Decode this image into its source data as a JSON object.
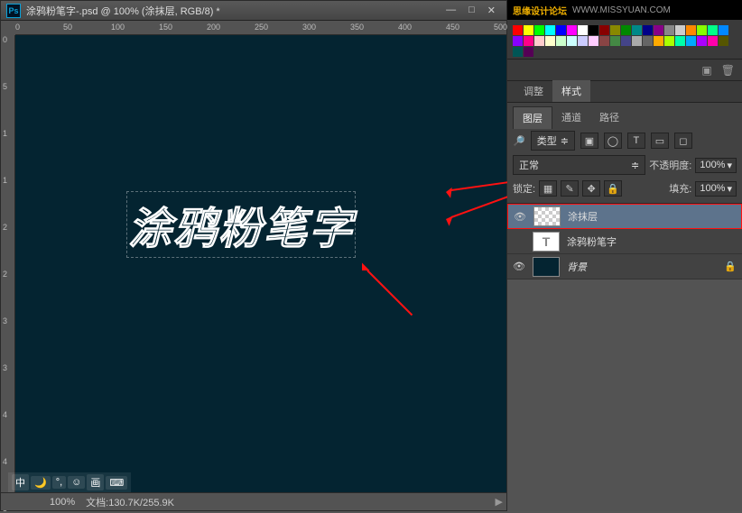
{
  "title": "涂鸦粉笔字-.psd @ 100% (涂抹层, RGB/8) *",
  "rulerH": [
    "0",
    "50",
    "100",
    "150",
    "200",
    "250",
    "300",
    "350",
    "400",
    "450",
    "500"
  ],
  "rulerV": [
    "0",
    "5",
    "1",
    "1",
    "2",
    "2",
    "3",
    "3",
    "4",
    "4",
    "5"
  ],
  "canvasText": "涂鸦粉笔字",
  "status": {
    "zoom": "100%",
    "docinfo": "文档:130.7K/255.9K"
  },
  "taskbar": [
    "中",
    "🌙",
    "°,",
    "☺",
    "画",
    "⌨"
  ],
  "watermark": {
    "brand": "思缘设计论坛",
    "url": "WWW.MISSYUAN.COM"
  },
  "tabsTop": {
    "adjust": "调整",
    "styles": "样式"
  },
  "tabsLayers": {
    "layers": "图层",
    "channels": "通道",
    "paths": "路径"
  },
  "filter": {
    "label": "类型",
    "icons": [
      "▣",
      "◯",
      "T",
      "▭",
      "◻"
    ]
  },
  "blend": {
    "mode": "正常",
    "opacityLabel": "不透明度:",
    "opacity": "100%"
  },
  "lock": {
    "label": "锁定:",
    "fillLabel": "填充:",
    "fill": "100%"
  },
  "layers": [
    {
      "name": "涂抹层",
      "type": "normal",
      "visible": true,
      "selected": true
    },
    {
      "name": "涂鸦粉笔字",
      "type": "text",
      "visible": false,
      "selected": false
    },
    {
      "name": "背景",
      "type": "bg",
      "visible": true,
      "selected": false,
      "locked": true
    }
  ]
}
